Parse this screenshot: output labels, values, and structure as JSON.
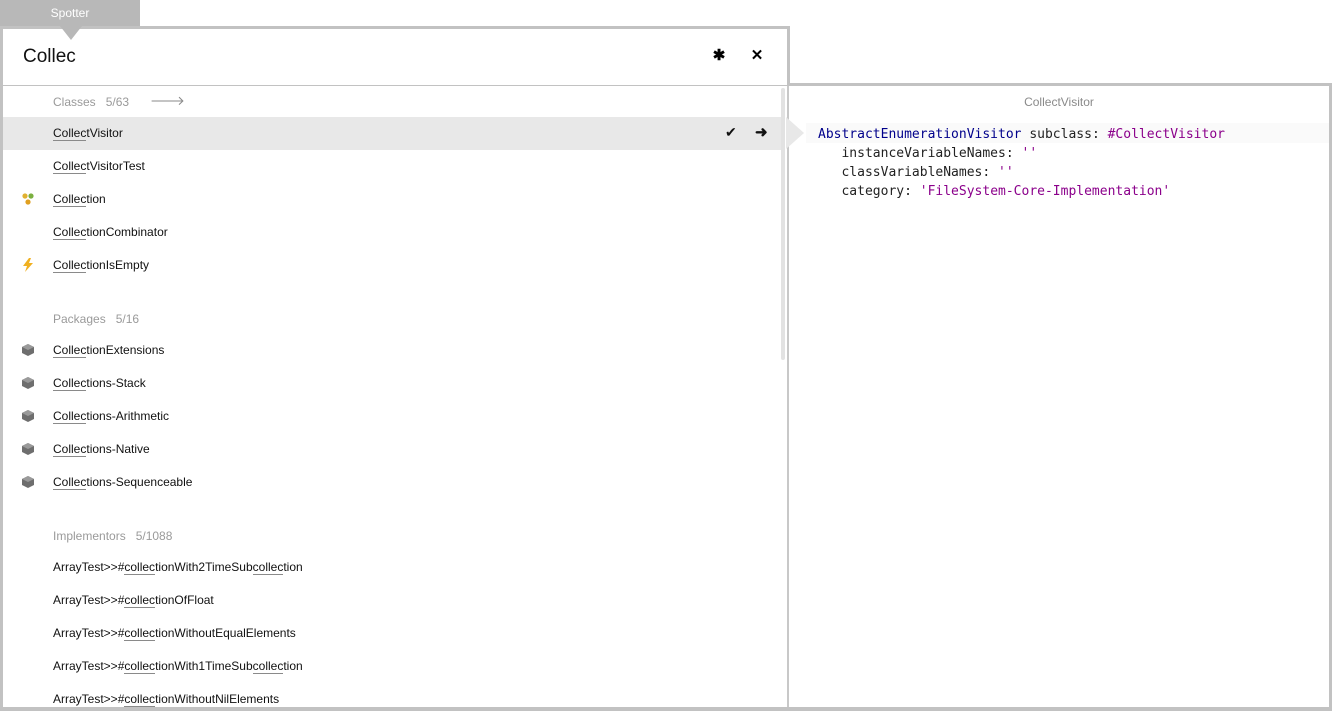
{
  "window": {
    "tab_label": "Spotter"
  },
  "search": {
    "query": "Collec"
  },
  "toolbar": {
    "settings_icon": "gear-icon",
    "close_icon": "close-icon"
  },
  "categories": {
    "classes": {
      "label": "Classes",
      "count": "5/63",
      "items": [
        {
          "match": "Collec",
          "rest": "tVisitor",
          "icon": "none"
        },
        {
          "match": "Collec",
          "rest": "tVisitorTest",
          "icon": "none"
        },
        {
          "match": "Collec",
          "rest": "tion",
          "icon": "trait-dots-icon"
        },
        {
          "match": "Collec",
          "rest": "tionCombinator",
          "icon": "none"
        },
        {
          "match": "Collec",
          "rest": "tionIsEmpty",
          "icon": "lightning-icon"
        }
      ]
    },
    "packages": {
      "label": "Packages",
      "count": "5/16",
      "items": [
        {
          "match": "Collec",
          "rest": "tionExtensions"
        },
        {
          "match": "Collec",
          "rest": "tions-Stack"
        },
        {
          "match": "Collec",
          "rest": "tions-Arithmetic"
        },
        {
          "match": "Collec",
          "rest": "tions-Native"
        },
        {
          "match": "Collec",
          "rest": "tions-Sequenceable"
        }
      ]
    },
    "implementors": {
      "label": "Implementors",
      "count": "5/1088",
      "items": [
        {
          "prefix": "ArrayTest>>#",
          "match": "collec",
          "mid": "tionWith2TimeSub",
          "match2": "collec",
          "rest": "tion"
        },
        {
          "prefix": "ArrayTest>>#",
          "match": "collec",
          "mid": "tionOfFloat",
          "match2": "",
          "rest": ""
        },
        {
          "prefix": "ArrayTest>>#",
          "match": "collec",
          "mid": "tionWithoutEqualElements",
          "match2": "",
          "rest": ""
        },
        {
          "prefix": "ArrayTest>>#",
          "match": "collec",
          "mid": "tionWith1TimeSub",
          "match2": "collec",
          "rest": "tion"
        },
        {
          "prefix": "ArrayTest>>#",
          "match": "collec",
          "mid": "tionWithoutNilElements",
          "match2": "",
          "rest": ""
        }
      ]
    }
  },
  "preview": {
    "title": "CollectVisitor",
    "line1": {
      "superclass": "AbstractEnumerationVisitor",
      "keyword": " subclass: ",
      "symbol": "#CollectVisitor"
    },
    "line2": {
      "keyword": "   instanceVariableNames: ",
      "value": "''"
    },
    "line3": {
      "keyword": "   classVariableNames: ",
      "value": "''"
    },
    "line4": {
      "keyword": "   category: ",
      "value": "'FileSystem-Core-Implementation'"
    }
  }
}
